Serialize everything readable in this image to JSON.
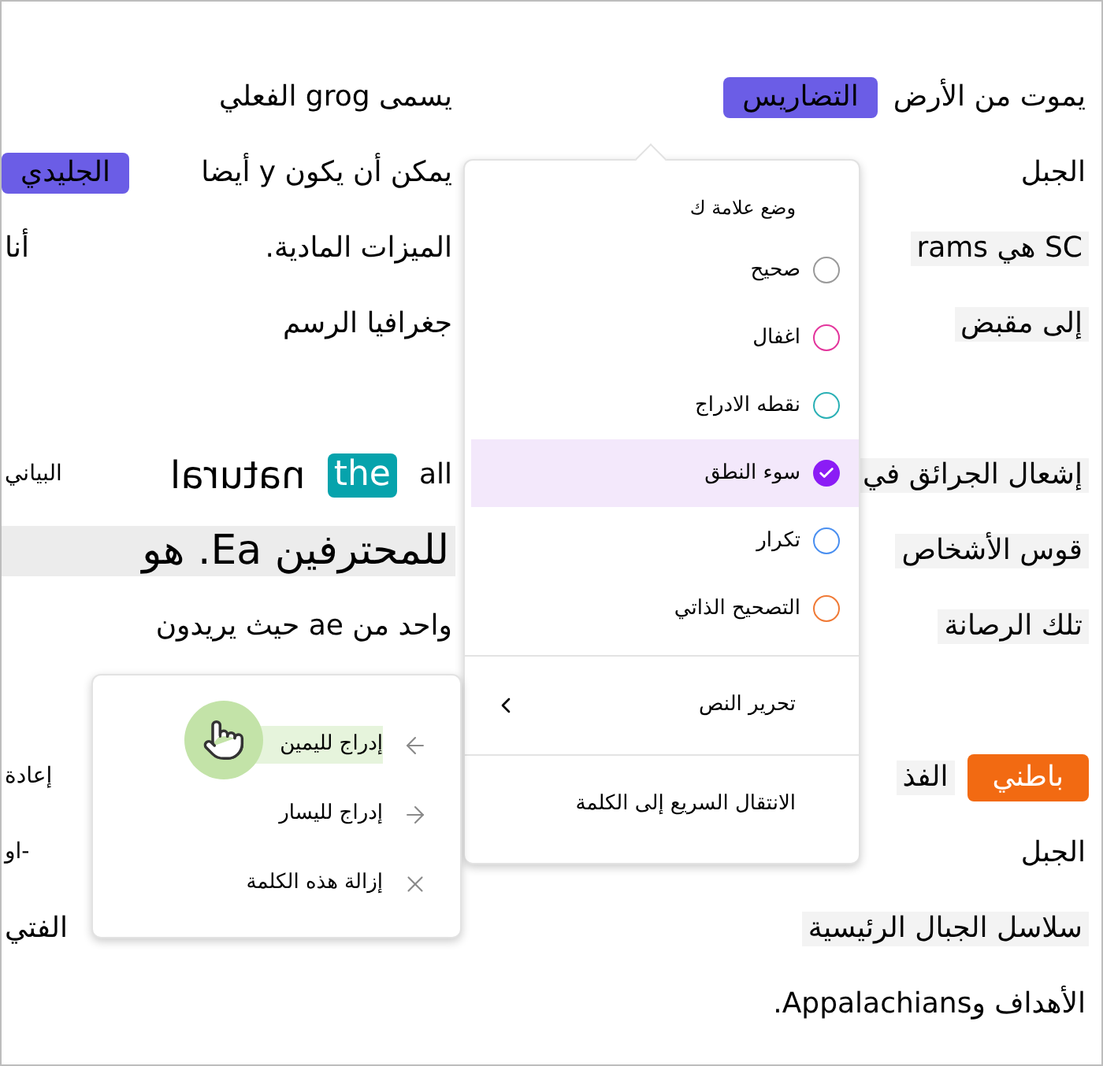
{
  "document_lines": [
    {
      "kind": "text",
      "right": [
        {
          "text": "يموت من الأرض",
          "kind": "plain"
        },
        {
          "text": "التضاريس",
          "kind": "purple"
        }
      ],
      "left": [
        {
          "text": "يسمى grog الفعلي",
          "kind": "plain"
        }
      ]
    },
    {
      "kind": "text",
      "right": [
        {
          "text": "الجبل",
          "kind": "plain"
        }
      ],
      "left": [
        {
          "text": "يمكن أن يكون y أيضا",
          "kind": "plain"
        }
      ],
      "margin": [
        {
          "text": "الجليدي",
          "kind": "purple"
        }
      ]
    },
    {
      "kind": "text",
      "right": [
        {
          "text": "SC هي rams",
          "kind": "shaded"
        }
      ],
      "left": [
        {
          "text": "الميزات المادية.",
          "kind": "plain"
        }
      ],
      "margin": [
        {
          "text": "أنا",
          "kind": "plain"
        }
      ]
    },
    {
      "kind": "text",
      "right": [
        {
          "text": "إلى مقبض",
          "kind": "shaded"
        }
      ],
      "left": [
        {
          "text": "جغرافيا الرسم",
          "kind": "plain"
        }
      ]
    },
    {
      "kind": "blank"
    },
    {
      "kind": "text",
      "right": [
        {
          "text": "إشعال الجرائق في",
          "kind": "shaded"
        }
      ],
      "left": [
        {
          "text": "all",
          "kind": "plain"
        },
        {
          "text": "the",
          "kind": "teal"
        },
        {
          "text": "natural",
          "kind": "mirrored"
        }
      ],
      "margin": [
        {
          "text": "البياني",
          "kind": "small"
        }
      ]
    },
    {
      "kind": "text",
      "right": [
        {
          "text": "قوس الأشخاص",
          "kind": "shaded"
        }
      ],
      "left": [
        {
          "text": "للمحترفين Ea. هو",
          "kind": "large_shaded"
        }
      ]
    },
    {
      "kind": "text",
      "right": [
        {
          "text": "تلك الرصانة",
          "kind": "shaded"
        }
      ],
      "left": [
        {
          "text": "واحد من ae حيث يريدون",
          "kind": "plain"
        }
      ]
    },
    {
      "kind": "blank"
    },
    {
      "kind": "text",
      "right": [
        {
          "text": "باطني",
          "kind": "orange"
        },
        {
          "text": "الفذ",
          "kind": "shaded"
        }
      ],
      "margin": [
        {
          "text": "إعادة",
          "kind": "small"
        }
      ]
    },
    {
      "kind": "text",
      "right": [
        {
          "text": "الجبل",
          "kind": "plain"
        }
      ],
      "margin": [
        {
          "text": "-او",
          "kind": "small"
        }
      ]
    },
    {
      "kind": "text",
      "right": [
        {
          "text": "سلاسل الجبال الرئيسية",
          "kind": "shaded"
        }
      ],
      "margin": [
        {
          "text": "الفتي",
          "kind": "plain"
        }
      ]
    },
    {
      "kind": "text",
      "right": [
        {
          "text": "الأهداف وAppalachians.",
          "kind": "plain"
        }
      ]
    }
  ],
  "mark_menu": {
    "header": "وضع علامة ك",
    "options": [
      {
        "label": "صحيح",
        "color": "#9a9a9a",
        "selected": false
      },
      {
        "label": "اغفال",
        "color": "#e3359c",
        "selected": false
      },
      {
        "label": "نقطه الادراج",
        "color": "#2ab0b5",
        "selected": false
      },
      {
        "label": "سوء النطق",
        "color": "#8b1cf5",
        "selected": true
      },
      {
        "label": "تكرار",
        "color": "#4a8ff0",
        "selected": false
      },
      {
        "label": "التصحيح الذاتي",
        "color": "#f07a36",
        "selected": false
      }
    ],
    "actions": [
      {
        "label": "تحرير النص",
        "kind": "submenu"
      },
      {
        "label": "الانتقال السريع إلى الكلمة",
        "kind": "plain"
      }
    ]
  },
  "edit_submenu": {
    "items": [
      {
        "label": "إدراج لليمين",
        "kind": "insert_right",
        "highlighted": true
      },
      {
        "label": "إدراج لليسار",
        "kind": "insert_left",
        "highlighted": false
      },
      {
        "label": "إزالة هذه الكلمة",
        "kind": "remove",
        "highlighted": false
      }
    ]
  }
}
